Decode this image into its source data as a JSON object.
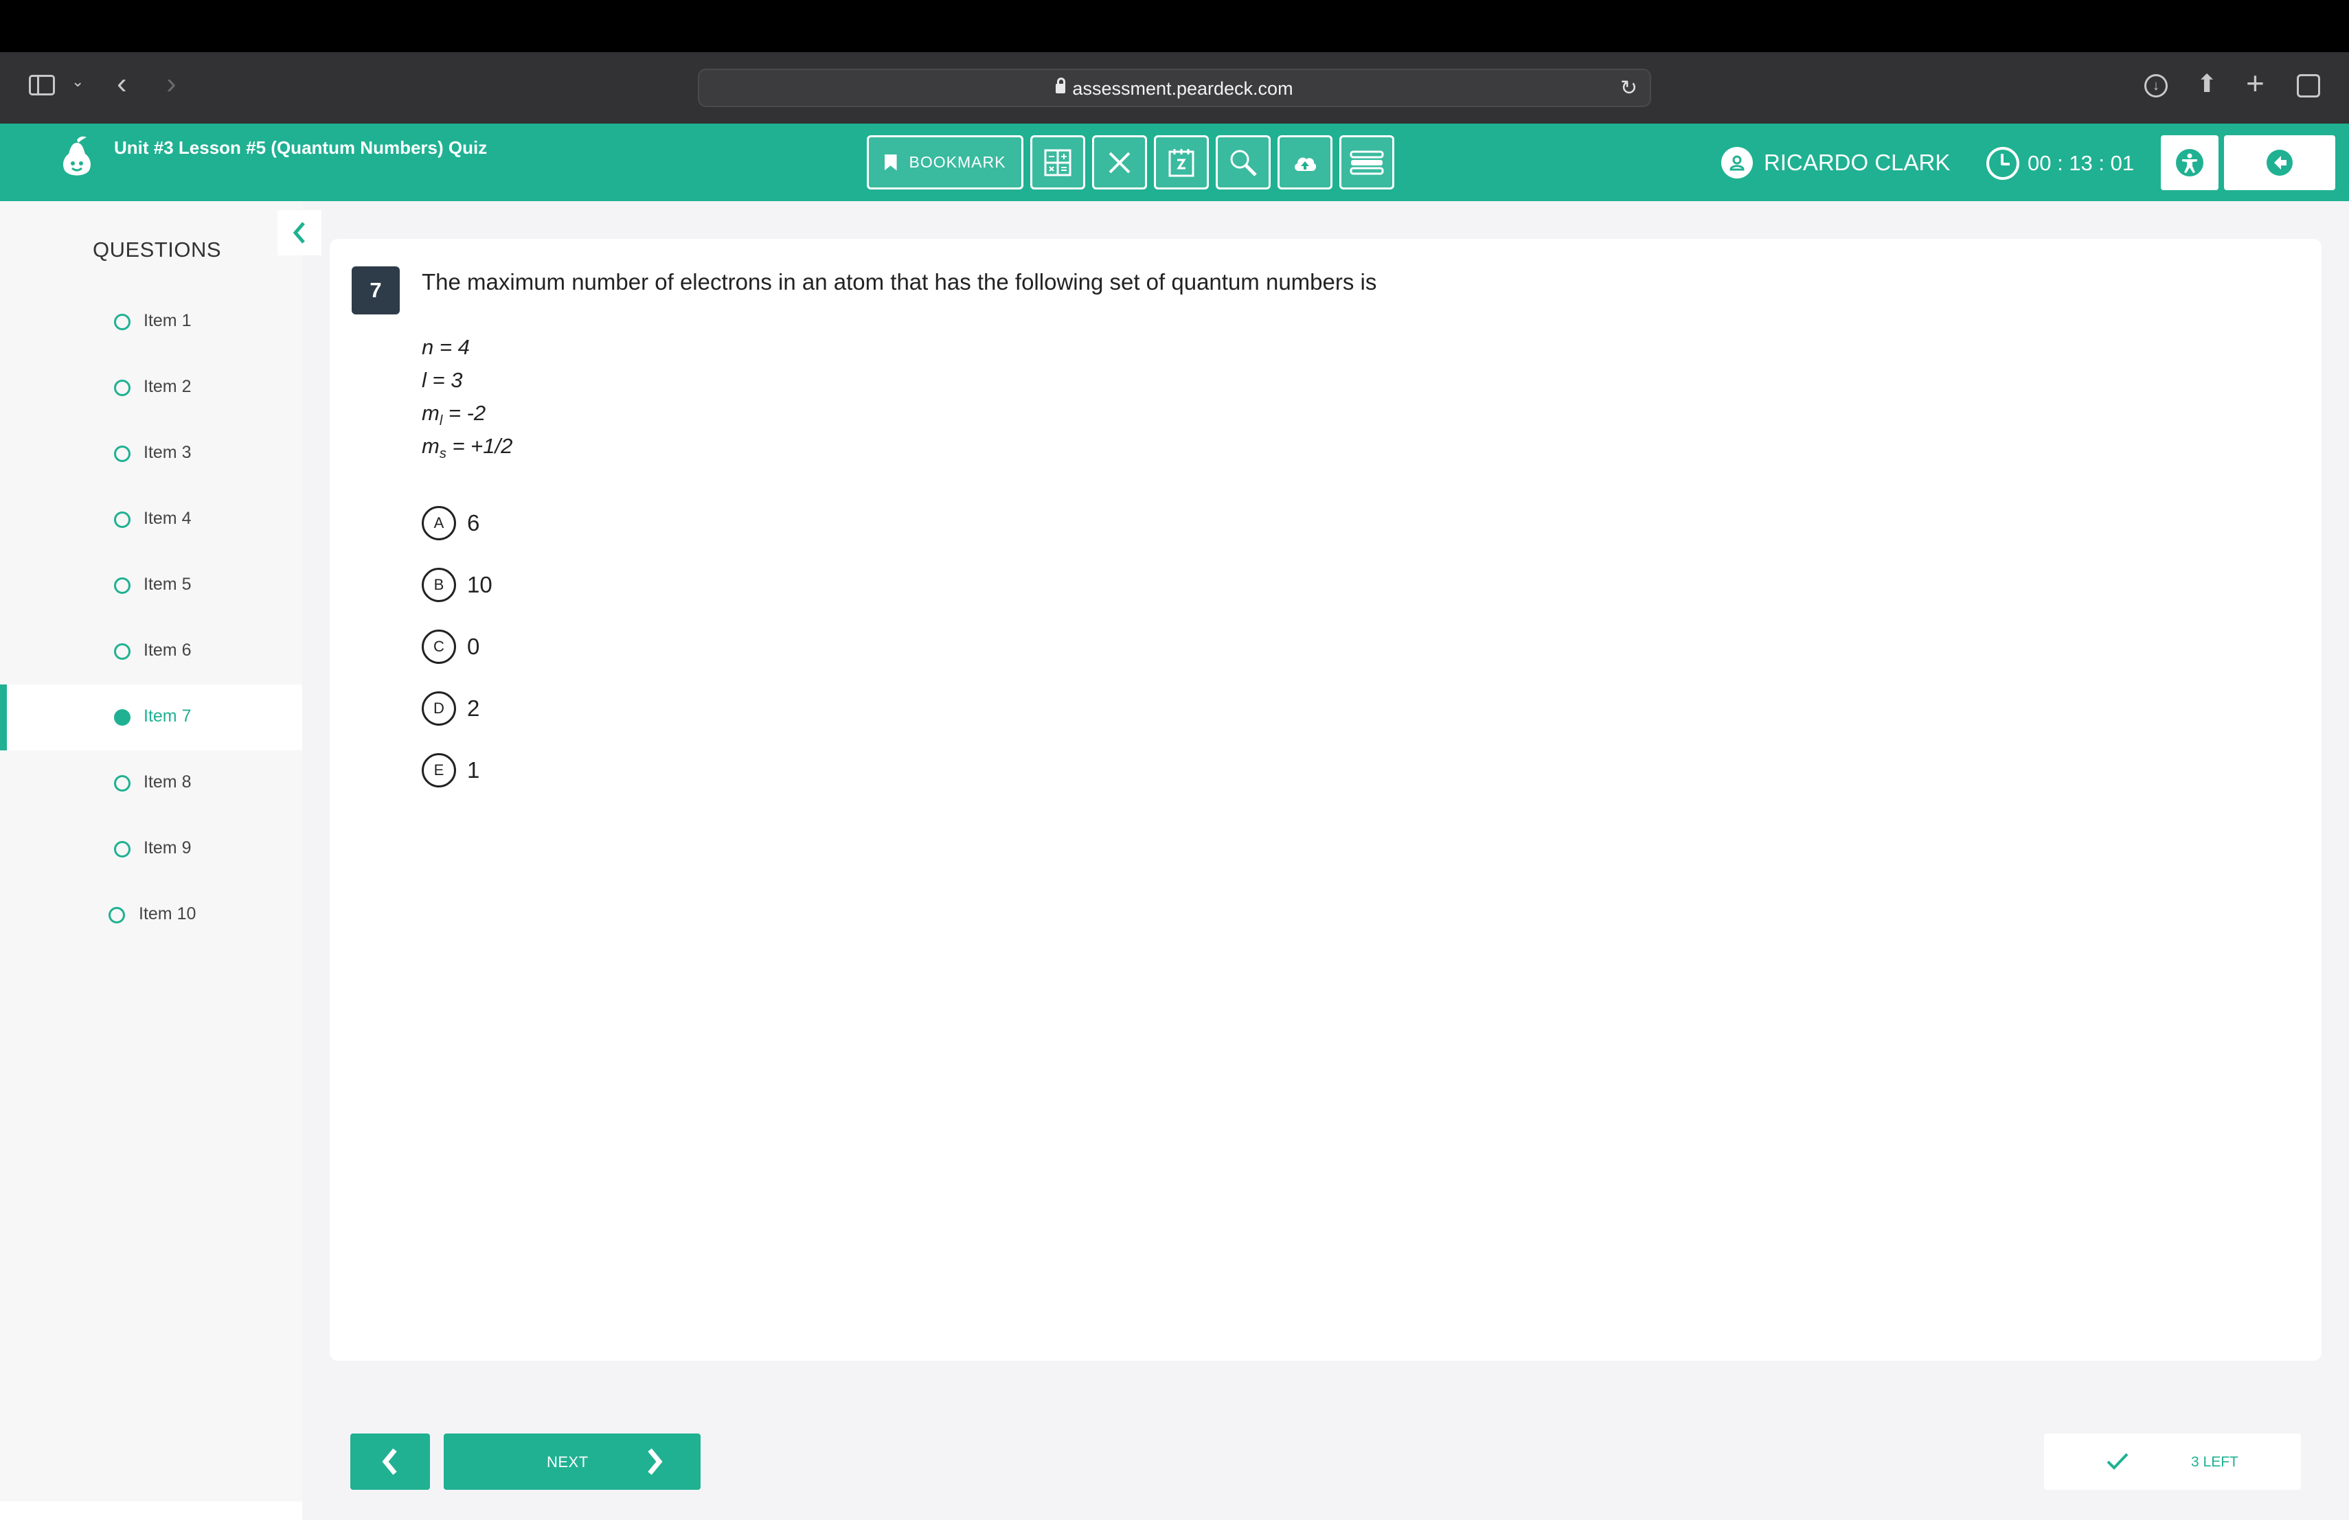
{
  "browser": {
    "url": "assessment.peardeck.com"
  },
  "app": {
    "quiz_title": "Unit #3 Lesson #5 (Quantum Numbers) Quiz",
    "bookmark_label": "BOOKMARK",
    "user_name": "RICARDO CLARK",
    "timer": "00 : 13 : 01",
    "accent_color": "#1fb192"
  },
  "sidebar": {
    "heading": "QUESTIONS",
    "items": [
      {
        "label": "Item 1"
      },
      {
        "label": "Item 2"
      },
      {
        "label": "Item 3"
      },
      {
        "label": "Item 4"
      },
      {
        "label": "Item 5"
      },
      {
        "label": "Item 6"
      },
      {
        "label": "Item 7",
        "active": true
      },
      {
        "label": "Item 8"
      },
      {
        "label": "Item 9"
      },
      {
        "label": "Item 10"
      }
    ]
  },
  "question": {
    "number": "7",
    "text": "The maximum number of electrons in an atom that has the following set of quantum numbers is",
    "quantum_numbers": [
      {
        "symbol": "n",
        "sub": "",
        "value": " = 4"
      },
      {
        "symbol": "l",
        "sub": "",
        "value": " = 3"
      },
      {
        "symbol": "m",
        "sub": "l",
        "value": " = -2"
      },
      {
        "symbol": "m",
        "sub": "s",
        "value": " = +1/2"
      }
    ],
    "options": [
      {
        "letter": "A",
        "text": "6"
      },
      {
        "letter": "B",
        "text": "10"
      },
      {
        "letter": "C",
        "text": "0"
      },
      {
        "letter": "D",
        "text": "2"
      },
      {
        "letter": "E",
        "text": "1"
      }
    ]
  },
  "footer": {
    "next_label": "NEXT",
    "remaining_label": "3 LEFT"
  }
}
